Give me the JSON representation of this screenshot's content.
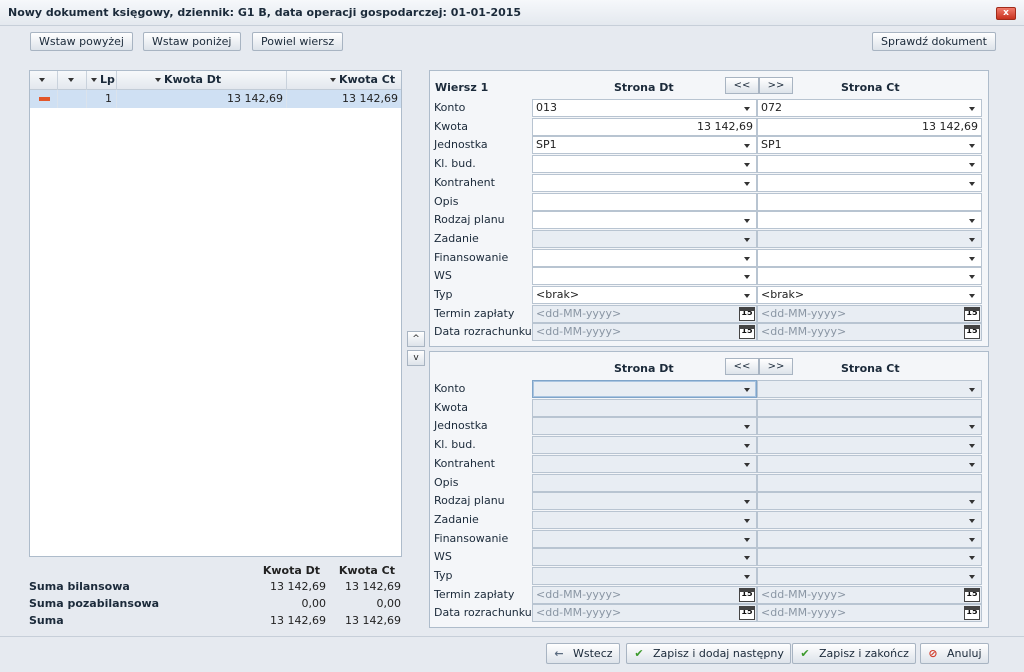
{
  "window": {
    "title": "Nowy dokument księgowy, dziennik: G1 B, data operacji gospodarczej: 01-01-2015",
    "close_label": "x"
  },
  "toolbar": {
    "insert_above": "Wstaw powyżej",
    "insert_below": "Wstaw poniżej",
    "duplicate_row": "Powiel wiersz",
    "check_document": "Sprawdź dokument"
  },
  "grid": {
    "headers": {
      "lp": "Lp",
      "kwota_dt": "Kwota Dt",
      "kwota_ct": "Kwota Ct"
    },
    "rows": [
      {
        "lp": "1",
        "kwota_dt": "13 142,69",
        "kwota_ct": "13 142,69"
      }
    ]
  },
  "summary": {
    "col_dt": "Kwota Dt",
    "col_ct": "Kwota Ct",
    "rows": [
      {
        "label": "Suma bilansowa",
        "dt": "13 142,69",
        "ct": "13 142,69"
      },
      {
        "label": "Suma pozabilansowa",
        "dt": "0,00",
        "ct": "0,00"
      },
      {
        "label": "Suma",
        "dt": "13 142,69",
        "ct": "13 142,69"
      }
    ]
  },
  "form1": {
    "row_label": "Wiersz 1",
    "side_dt": "Strona Dt",
    "side_ct": "Strona Ct",
    "prev": "<<",
    "next": ">>",
    "labels": [
      "Konto",
      "Kwota",
      "Jednostka",
      "Kl. bud.",
      "Kontrahent",
      "Opis",
      "Rodzaj planu",
      "Zadanie",
      "Finansowanie",
      "WS",
      "Typ",
      "Termin zapłaty",
      "Data rozrachunku"
    ],
    "dt": {
      "konto": "013",
      "kwota": "13 142,69",
      "jednostka": "SP1",
      "typ": "<brak>",
      "date_placeholder": "<dd-MM-yyyy>"
    },
    "ct": {
      "konto": "072",
      "kwota": "13 142,69",
      "jednostka": "SP1",
      "typ": "<brak>",
      "date_placeholder": "<dd-MM-yyyy>"
    }
  },
  "form2": {
    "side_dt": "Strona Dt",
    "side_ct": "Strona Ct",
    "prev": "<<",
    "next": ">>",
    "labels": [
      "Konto",
      "Kwota",
      "Jednostka",
      "Kl. bud.",
      "Kontrahent",
      "Opis",
      "Rodzaj planu",
      "Zadanie",
      "Finansowanie",
      "WS",
      "Typ",
      "Termin zapłaty",
      "Data rozrachunku"
    ],
    "date_placeholder": "<dd-MM-yyyy>"
  },
  "move": {
    "up": "^",
    "down": "v"
  },
  "calendar_day": "15",
  "footer": {
    "back": "Wstecz",
    "save_add_next": "Zapisz i dodaj następny",
    "save_finish": "Zapisz i zakończ",
    "cancel": "Anuluj"
  }
}
